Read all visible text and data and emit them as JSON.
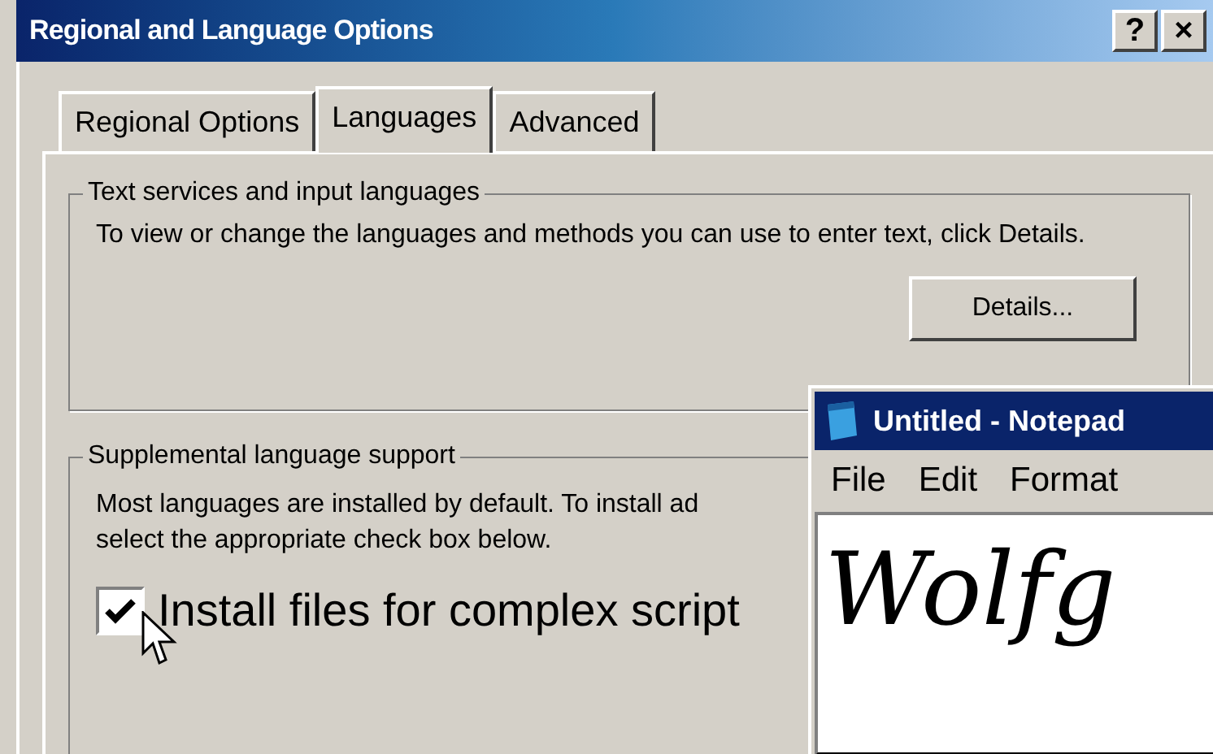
{
  "window": {
    "title": "Regional and Language Options",
    "buttons": [
      "?",
      "×"
    ]
  },
  "tabs": [
    {
      "label": "Regional Options",
      "selected": false
    },
    {
      "label": "Languages",
      "selected": true
    },
    {
      "label": "Advanced",
      "selected": false
    }
  ],
  "text_services": {
    "title": "Text services and input languages",
    "description": "To view or change the languages and methods you can use to enter text, click Details.",
    "button": "Details..."
  },
  "supplemental": {
    "title": "Supplemental language support",
    "description_lines": [
      "Most languages are installed by default. To install ad",
      "select the appropriate check box below."
    ],
    "checkbox": {
      "label": "Install files for complex script",
      "checked": true
    }
  },
  "notepad": {
    "title": "Untitled - Notepad",
    "menu": [
      "File",
      "Edit",
      "Format"
    ],
    "text": "Wolfg"
  }
}
